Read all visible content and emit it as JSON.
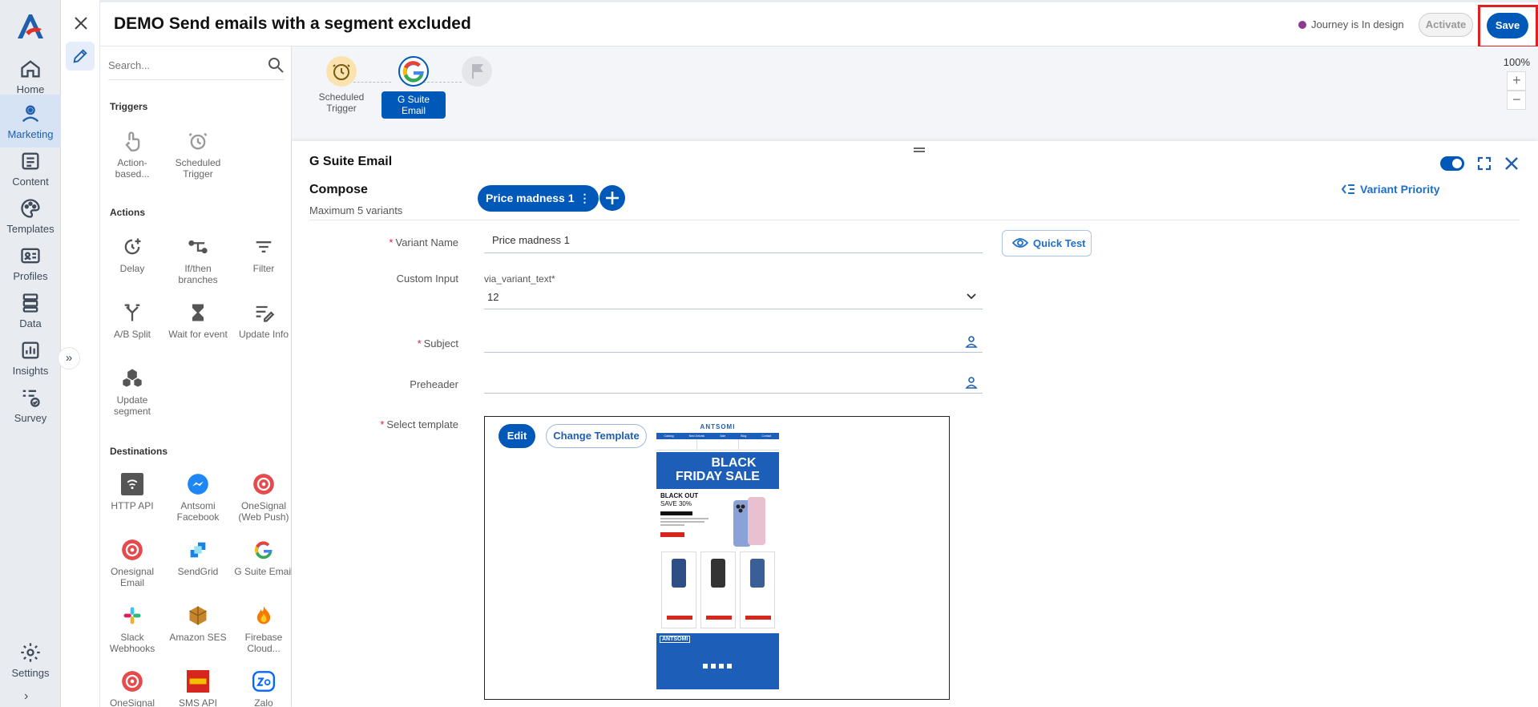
{
  "nav": {
    "items": [
      {
        "label": "Home",
        "icon": "home-icon"
      },
      {
        "label": "Marketing",
        "icon": "marketing-icon",
        "active": true
      },
      {
        "label": "Content",
        "icon": "content-icon"
      },
      {
        "label": "Templates",
        "icon": "palette-icon"
      },
      {
        "label": "Profiles",
        "icon": "profile-card-icon"
      },
      {
        "label": "Data",
        "icon": "database-icon"
      },
      {
        "label": "Insights",
        "icon": "chart-icon"
      },
      {
        "label": "Survey",
        "icon": "survey-icon"
      },
      {
        "label": "Settings",
        "icon": "gear-icon"
      }
    ]
  },
  "header": {
    "title": "DEMO Send emails with a segment excluded",
    "status": "Journey is In design",
    "status_color": "#8b3b8f",
    "activate_label": "Activate",
    "save_label": "Save"
  },
  "palette": {
    "search_placeholder": "Search...",
    "triggers_title": "Triggers",
    "triggers": [
      "Action-based...",
      "Scheduled Trigger"
    ],
    "actions_title": "Actions",
    "actions": [
      "Delay",
      "If/then branches",
      "Filter",
      "A/B Split",
      "Wait for event",
      "Update Info",
      "Update segment"
    ],
    "destinations_title": "Destinations",
    "destinations": [
      "HTTP API",
      "Antsomi Facebook",
      "OneSignal (Web Push)",
      "Onesignal Email",
      "SendGrid",
      "G Suite Email",
      "Slack Webhooks",
      "Amazon SES",
      "Firebase Cloud...",
      "OneSignal",
      "SMS API",
      "Zalo"
    ]
  },
  "flow": {
    "nodes": [
      "Scheduled Trigger",
      "G Suite Email"
    ],
    "zoom": "100%"
  },
  "panel": {
    "title": "G Suite Email",
    "compose": "Compose",
    "max_variants": "Maximum 5 variants",
    "variant_pill": "Price madness 1",
    "variant_priority": "Variant Priority",
    "variant_name_label": "Variant Name",
    "variant_name_value": "Price madness 1",
    "quick_test": "Quick Test",
    "custom_input_label": "Custom Input",
    "custom_input_sublabel": "via_variant_text*",
    "custom_input_value": "12",
    "subject_label": "Subject",
    "preheader_label": "Preheader",
    "select_template_label": "Select template",
    "edit_label": "Edit",
    "change_template_label": "Change Template"
  },
  "email_preview": {
    "brand": "ANTSOMI",
    "menu": [
      "Catalog",
      "New Arrivals",
      "Sale",
      "Blog",
      "Contact"
    ],
    "headline1": "BLACK",
    "headline2": "FRIDAY SALE",
    "blackout": "BLACK OUT",
    "save_line": "SAVE 30%",
    "promo_color": "#1d5fb8"
  }
}
